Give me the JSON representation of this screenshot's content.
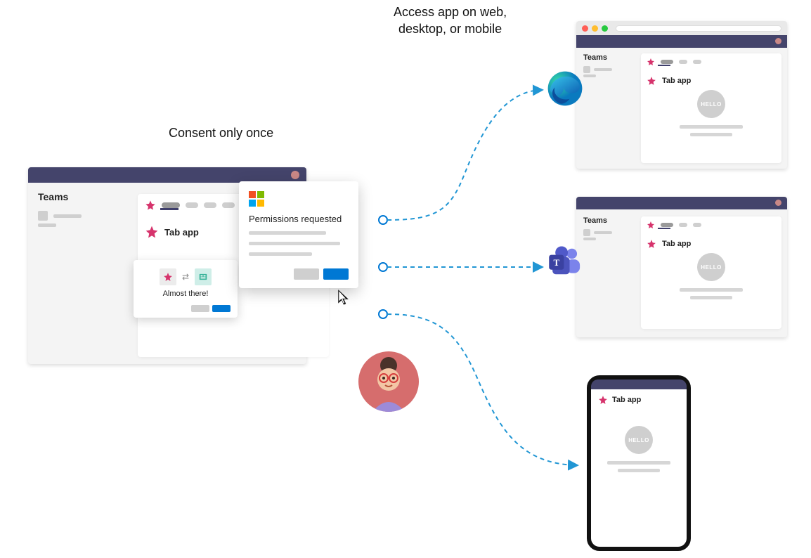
{
  "headings": {
    "consent": "Consent only once",
    "access": "Access app on web,\ndesktop, or mobile"
  },
  "consent_window": {
    "sidebar_title": "Teams",
    "tab_app_label": "Tab app",
    "almost_card": {
      "caption": "Almost there!"
    },
    "permission_dialog": {
      "title": "Permissions requested",
      "vendor_icon": "microsoft-logo"
    }
  },
  "targets": {
    "web": {
      "sidebar_title": "Teams",
      "tab_app_label": "Tab app",
      "hello": "HELLO"
    },
    "desktop": {
      "sidebar_title": "Teams",
      "tab_app_label": "Tab app",
      "hello": "HELLO"
    },
    "mobile": {
      "tab_app_label": "Tab app",
      "hello": "HELLO"
    }
  },
  "icons": {
    "star": "star-icon",
    "edge": "edge-browser-icon",
    "teams": "ms-teams-icon",
    "avatar": "user-avatar",
    "cursor": "mouse-cursor"
  },
  "colors": {
    "purple_bar": "#44446b",
    "accent_blue": "#0078d4",
    "arrow": "#2196d4"
  }
}
